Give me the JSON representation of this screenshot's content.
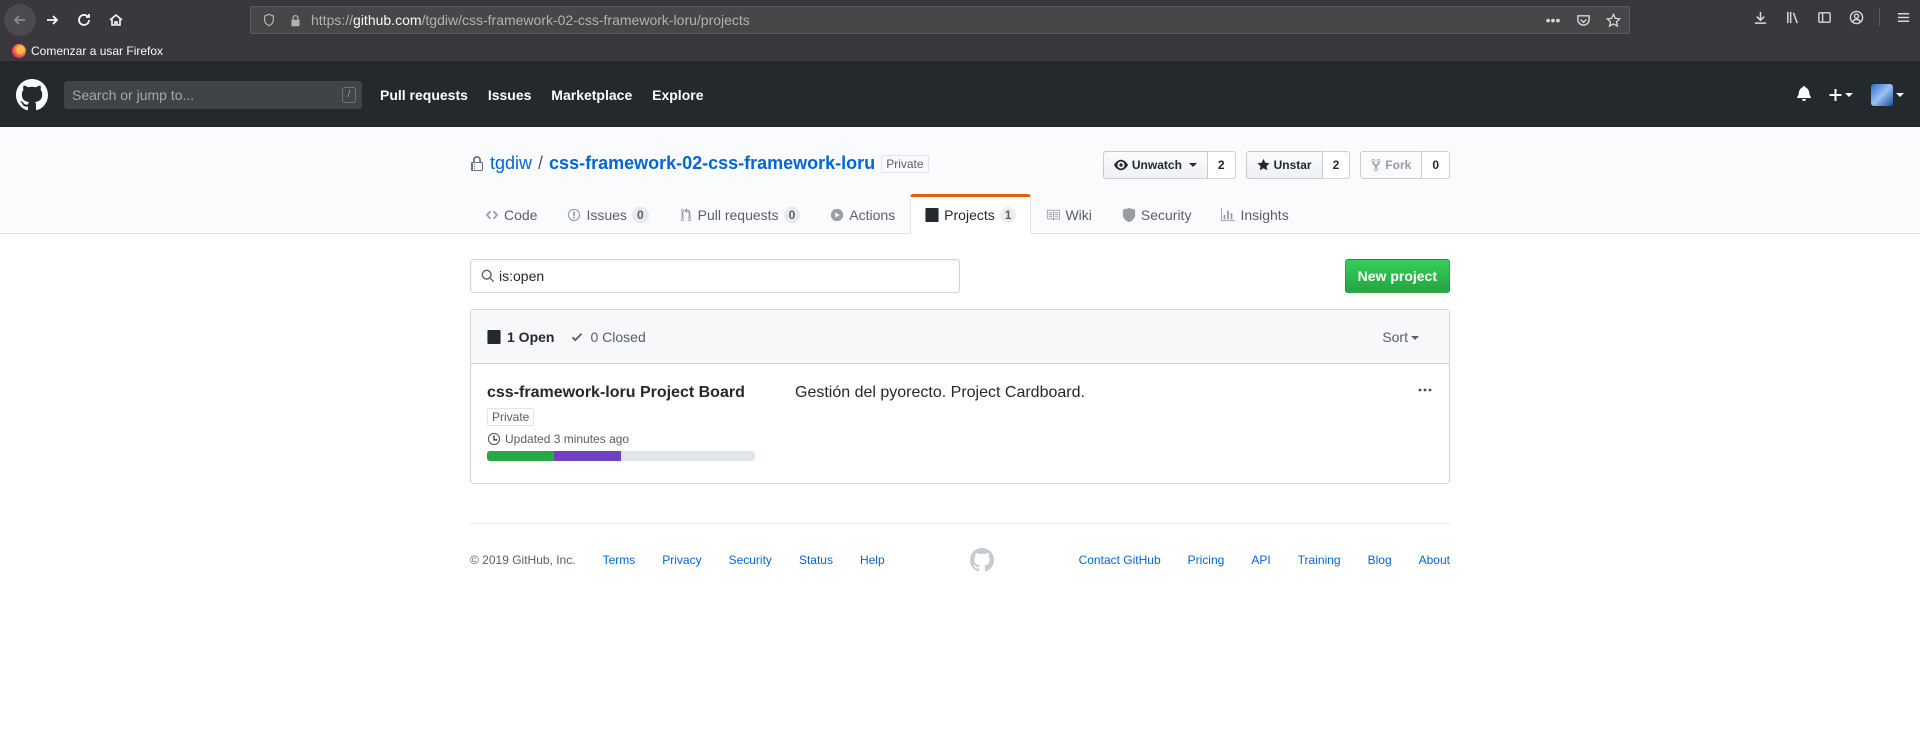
{
  "browser": {
    "url_prefix": "https://",
    "url_domain": "github.com",
    "url_path": "/tgdiw/css-framework-02-css-framework-loru/projects",
    "bookmark": "Comenzar a usar Firefox"
  },
  "header": {
    "search_placeholder": "Search or jump to...",
    "search_shortcut": "/",
    "nav": [
      "Pull requests",
      "Issues",
      "Marketplace",
      "Explore"
    ]
  },
  "repo": {
    "owner": "tgdiw",
    "separator": "/",
    "name": "css-framework-02-css-framework-loru",
    "visibility": "Private",
    "watch_label": "Unwatch",
    "watch_count": "2",
    "star_label": "Unstar",
    "star_count": "2",
    "fork_label": "Fork",
    "fork_count": "0"
  },
  "tabs": [
    {
      "label": "Code",
      "icon": "code-icon"
    },
    {
      "label": "Issues",
      "counter": "0",
      "icon": "issue-icon"
    },
    {
      "label": "Pull requests",
      "counter": "0",
      "icon": "pull-request-icon"
    },
    {
      "label": "Actions",
      "icon": "play-icon"
    },
    {
      "label": "Projects",
      "counter": "1",
      "icon": "project-icon",
      "selected": true
    },
    {
      "label": "Wiki",
      "icon": "book-icon"
    },
    {
      "label": "Security",
      "icon": "shield-icon"
    },
    {
      "label": "Insights",
      "icon": "graph-icon"
    }
  ],
  "projects": {
    "search_value": "is:open",
    "new_button": "New project",
    "open_label": "1 Open",
    "closed_label": "0 Closed",
    "sort_label": "Sort",
    "items": [
      {
        "name": "css-framework-loru Project Board",
        "visibility": "Private",
        "updated": "Updated 3 minutes ago",
        "description": "Gestión del pyorecto. Project Cardboard.",
        "progress_done_pct": 25,
        "progress_in_progress_pct": 25
      }
    ]
  },
  "footer": {
    "copyright": "© 2019 GitHub, Inc.",
    "left_links": [
      "Terms",
      "Privacy",
      "Security",
      "Status",
      "Help"
    ],
    "right_links": [
      "Contact GitHub",
      "Pricing",
      "API",
      "Training",
      "Blog",
      "About"
    ]
  },
  "colors": {
    "header_bg": "#24292e",
    "link": "#0366d6",
    "primary_button": "#28a745",
    "selected_tab_accent": "#e36209",
    "progress_done": "#28a745",
    "progress_in_progress": "#6f42c1"
  }
}
